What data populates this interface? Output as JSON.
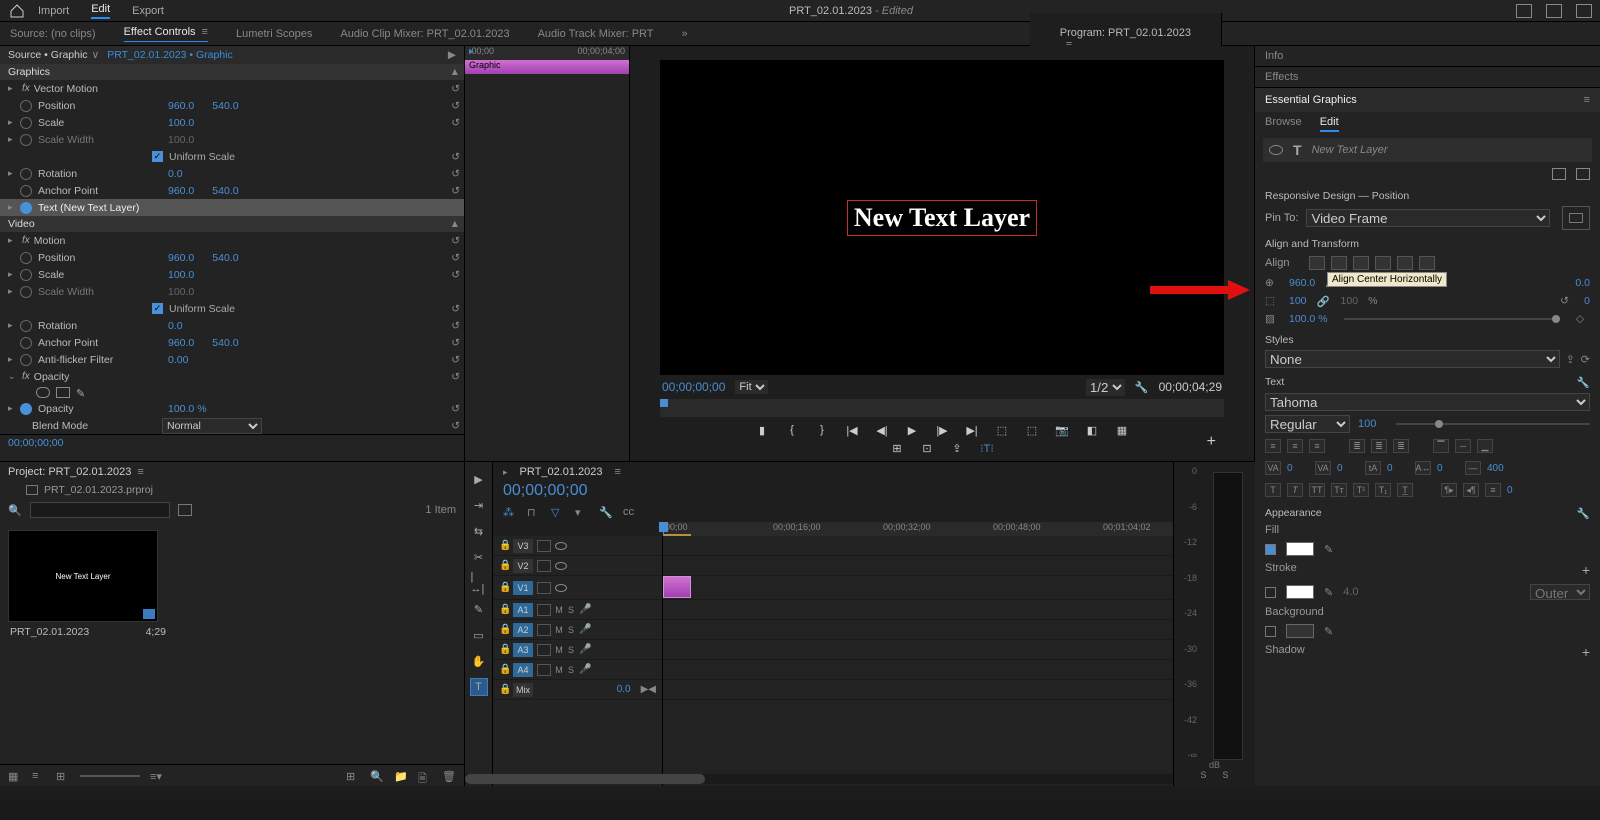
{
  "topbar": {
    "menu": {
      "import": "Import",
      "edit": "Edit",
      "export": "Export"
    },
    "title": "PRT_02.01.2023",
    "edited": "- Edited"
  },
  "tabs": {
    "source": "Source: (no clips)",
    "effect_controls": "Effect Controls",
    "lumetri": "Lumetri Scopes",
    "audio_clip": "Audio Clip Mixer: PRT_02.01.2023",
    "audio_track": "Audio Track Mixer: PRT",
    "program": "Program: PRT_02.01.2023"
  },
  "effect_controls": {
    "header_src": "Source • Graphic",
    "header_link": "PRT_02.01.2023 • Graphic",
    "section_graphics": "Graphics",
    "vector_motion": "Vector Motion",
    "position": "Position",
    "pos_x": "960.0",
    "pos_y": "540.0",
    "scale": "Scale",
    "scale_v": "100.0",
    "scale_width": "Scale Width",
    "scale_width_v": "100.0",
    "uniform": "Uniform Scale",
    "rotation": "Rotation",
    "rotation_v": "0.0",
    "anchor": "Anchor Point",
    "anchor_x": "960.0",
    "anchor_y": "540.0",
    "text_layer": "Text (New Text Layer)",
    "section_video": "Video",
    "motion": "Motion",
    "antiflicker": "Anti-flicker Filter",
    "antiflicker_v": "0.00",
    "opacity": "Opacity",
    "opacity_v": "100.0 %",
    "blend": "Blend Mode",
    "blend_v": "Normal",
    "tc": "00;00;00;00"
  },
  "ec_timeline": {
    "start": ":00;00",
    "end": "00;00;04;00",
    "clip": "Graphic"
  },
  "program": {
    "text": "New Text Layer",
    "tc_left": "00;00;00;00",
    "fit": "Fit",
    "zoom": "1/2",
    "tc_right": "00;00;04;29"
  },
  "essential_graphics": {
    "tab_info": "Info",
    "tab_effects": "Effects",
    "title": "Essential Graphics",
    "browse": "Browse",
    "edit": "Edit",
    "layer": "New Text Layer",
    "responsive": "Responsive Design — Position",
    "pin_to": "Pin To:",
    "pin_v": "Video Frame",
    "align_transform": "Align and Transform",
    "align": "Align",
    "tooltip": "Align Center Horizontally",
    "pos_x": "960.0",
    "pos_unit": ",",
    "pos_y2": "0.0",
    "scale": "100",
    "scale2": "100",
    "pct": "%",
    "rot": "0",
    "opacity": "100.0 %",
    "styles": "Styles",
    "style_v": "None",
    "text": "Text",
    "font": "Tahoma",
    "weight": "Regular",
    "size": "100",
    "va": "0",
    "tracking": "0",
    "leading": "0",
    "tsume": "0",
    "baseline": "400",
    "appearance": "Appearance",
    "fill": "Fill",
    "stroke": "Stroke",
    "stroke_v": "4.0",
    "outer": "Outer",
    "background": "Background",
    "shadow": "Shadow"
  },
  "project": {
    "title": "Project: PRT_02.01.2023",
    "file": "PRT_02.01.2023.prproj",
    "count": "1 Item",
    "thumb_text": "New Text Layer",
    "name": "PRT_02.01.2023",
    "dur": "4;29"
  },
  "timeline": {
    "name": "PRT_02.01.2023",
    "tc": "00;00;00;00",
    "ruler": [
      "00;00",
      "00;00;16;00",
      "00;00;32;00",
      "00;00;48;00",
      "00;01;04;02"
    ],
    "tracks_v": [
      "V3",
      "V2",
      "V1"
    ],
    "tracks_a": [
      "A1",
      "A2",
      "A3",
      "A4"
    ],
    "mix": "Mix",
    "mix_v": "0.0",
    "meter_scale": [
      "0",
      "-6",
      "-12",
      "-18",
      "-24",
      "-30",
      "-36",
      "-42",
      "-∞"
    ],
    "db": "dB",
    "s": "S"
  }
}
